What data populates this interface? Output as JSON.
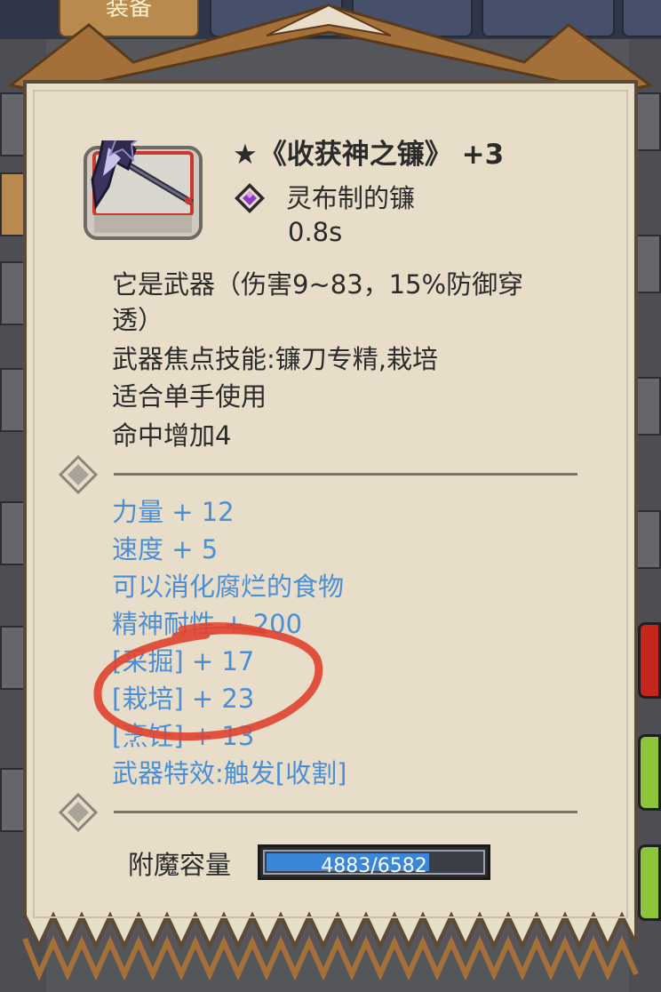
{
  "background": {
    "tabs": [
      {
        "label": "装备",
        "active": true
      },
      {
        "label": "",
        "active": false
      },
      {
        "label": "",
        "active": false
      },
      {
        "label": "",
        "active": false
      },
      {
        "label": "",
        "active": false
      }
    ]
  },
  "item": {
    "star": "★",
    "name": "《收获神之镰》",
    "enhance": "+3",
    "material": "灵布制的镰",
    "speed": "0.8s",
    "gem_color": "#8e3cc4"
  },
  "description": [
    "它是武器（伤害9~83，15%防御穿",
    "透）",
    "武器焦点技能:镰刀专精,栽培",
    "适合单手使用",
    "命中增加4"
  ],
  "stats": [
    "力量 + 12",
    "速度 + 5",
    "可以消化腐烂的食物",
    "精神耐性 + 200",
    "[采掘] + 17",
    "[栽培] + 23",
    "[烹饪] + 13",
    "武器特效:触发[收割]"
  ],
  "enchant": {
    "label": "附魔容量",
    "value_text": "4883/6582",
    "current": 4883,
    "max": 6582
  },
  "colors": {
    "stat_text": "#4a8fd6",
    "card_bg": "#e8ddc8",
    "annotation": "#e0432f"
  }
}
